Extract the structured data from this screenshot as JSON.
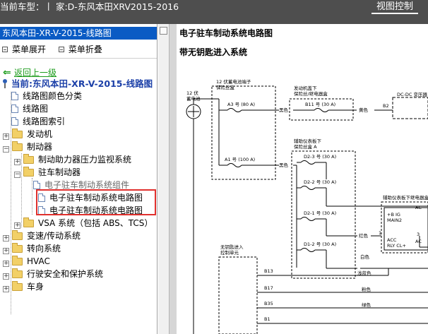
{
  "topbar": {
    "car_model": "当前车型：丨 家:D-东风本田XRV2015-2016",
    "view_control": "视图控制"
  },
  "left": {
    "title": "东风本田-XR-V-2015-线路图",
    "menu": {
      "expand": "菜单展开",
      "collapse": "菜单折叠"
    },
    "back": "返回上一级",
    "current": "当前:东风本田-XR-V-2015-线路图",
    "tree": [
      {
        "label": "线路图颜色分类"
      },
      {
        "label": "线路图"
      },
      {
        "label": "线路图索引"
      },
      {
        "label": "发动机"
      },
      {
        "label": "制动器"
      },
      {
        "label": "制动助力器压力监视系统"
      },
      {
        "label": "驻车制动器"
      },
      {
        "label": "电子驻车制动系统组件"
      },
      {
        "label": "电子驻车制动系统电路图"
      },
      {
        "label": "电子驻车制动系统电路图"
      },
      {
        "label": "VSA 系统（包括  ABS、TCS）"
      },
      {
        "label": "变速/传动系统"
      },
      {
        "label": "转向系统"
      },
      {
        "label": "HVAC"
      },
      {
        "label": "行驶安全和保护系统"
      },
      {
        "label": "车身"
      }
    ]
  },
  "diagram": {
    "title": "电子驻车制动系统电路图",
    "subtitle": "带无钥匙进入系统",
    "labels": {
      "battery": "12 伏\n蓄电池",
      "fusebox1": "12 伏蓄电池端子\n保险丝盒",
      "fusebox2": "发动机盖下\n保险丝/继电器盒",
      "fusebox3": "辅助仪表板下\n保险丝盒 A",
      "fusebox4": "辅助仪表板下继电器盒",
      "dcdc": "DC-DC 变压器",
      "a3": "A3 号 (80 A)",
      "a1": "A1 号 (100 A)",
      "b11": "B11 号 (30 A)",
      "d23": "D2-3 号 (30 A)",
      "d22": "D2-2 号 (30 A)",
      "d21": "D2-1 号 (30 A)",
      "d12": "D1-2 号 (30 A)",
      "ignition": "+B IG\nMAIN2",
      "acc": "ACC\nRLY CL+",
      "c1": "AC",
      "c2": "AC",
      "black1": "黑色",
      "black2": "黑色",
      "yellow": "黄色",
      "red": "红色",
      "white": "白色",
      "b2": "B2",
      "n1": "1",
      "n3": "3",
      "unit": "无钥匙进入\n控制单元",
      "b13": "B13",
      "b17": "B17",
      "b35": "B35",
      "b1": "B1",
      "lightblue": "浅蓝色",
      "pink": "粉色",
      "green": "绿色"
    }
  }
}
